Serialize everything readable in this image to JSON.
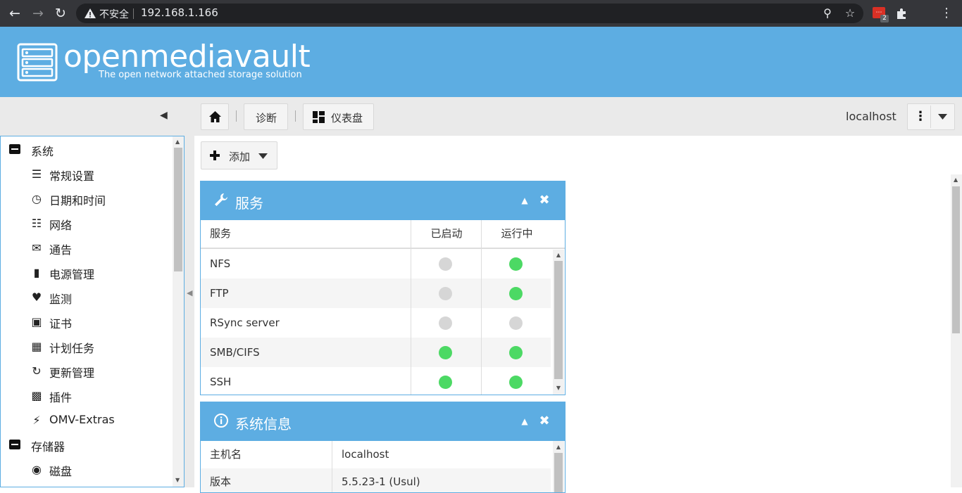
{
  "browser": {
    "security_label": "不安全",
    "url": "192.168.1.166",
    "extension_badge": "2"
  },
  "header": {
    "logo_text": "openmediavault",
    "tagline": "The open network attached storage solution"
  },
  "toolbar": {
    "diagnostics": "诊断",
    "dashboard": "仪表盘",
    "hostname": "localhost"
  },
  "sidebar": {
    "groups": [
      {
        "label": "系统",
        "items": [
          {
            "label": "常规设置",
            "icon": "sliders-icon"
          },
          {
            "label": "日期和时间",
            "icon": "clock-icon"
          },
          {
            "label": "网络",
            "icon": "network-icon"
          },
          {
            "label": "通告",
            "icon": "envelope-icon"
          },
          {
            "label": "电源管理",
            "icon": "battery-icon"
          },
          {
            "label": "监测",
            "icon": "heartbeat-icon"
          },
          {
            "label": "证书",
            "icon": "certificate-icon"
          },
          {
            "label": "计划任务",
            "icon": "calendar-clock-icon"
          },
          {
            "label": "更新管理",
            "icon": "refresh-icon"
          },
          {
            "label": "插件",
            "icon": "puzzle-icon"
          },
          {
            "label": "OMV-Extras",
            "icon": "plug-icon"
          }
        ]
      },
      {
        "label": "存储器",
        "items": [
          {
            "label": "磁盘",
            "icon": "disk-icon"
          }
        ]
      }
    ]
  },
  "main": {
    "add_label": "添加"
  },
  "services_panel": {
    "title": "服务",
    "columns": [
      "服务",
      "已启动",
      "运行中"
    ],
    "rows": [
      {
        "name": "NFS",
        "enabled": false,
        "running": true
      },
      {
        "name": "FTP",
        "enabled": false,
        "running": true
      },
      {
        "name": "RSync server",
        "enabled": false,
        "running": false
      },
      {
        "name": "SMB/CIFS",
        "enabled": true,
        "running": true
      },
      {
        "name": "SSH",
        "enabled": true,
        "running": true
      }
    ]
  },
  "sysinfo_panel": {
    "title": "系统信息",
    "rows": [
      {
        "key": "主机名",
        "value": "localhost"
      },
      {
        "key": "版本",
        "value": "5.5.23-1 (Usul)"
      }
    ]
  },
  "colors": {
    "brand": "#5dade2",
    "status_on": "#4cd964",
    "status_off": "#d6d6d6"
  }
}
